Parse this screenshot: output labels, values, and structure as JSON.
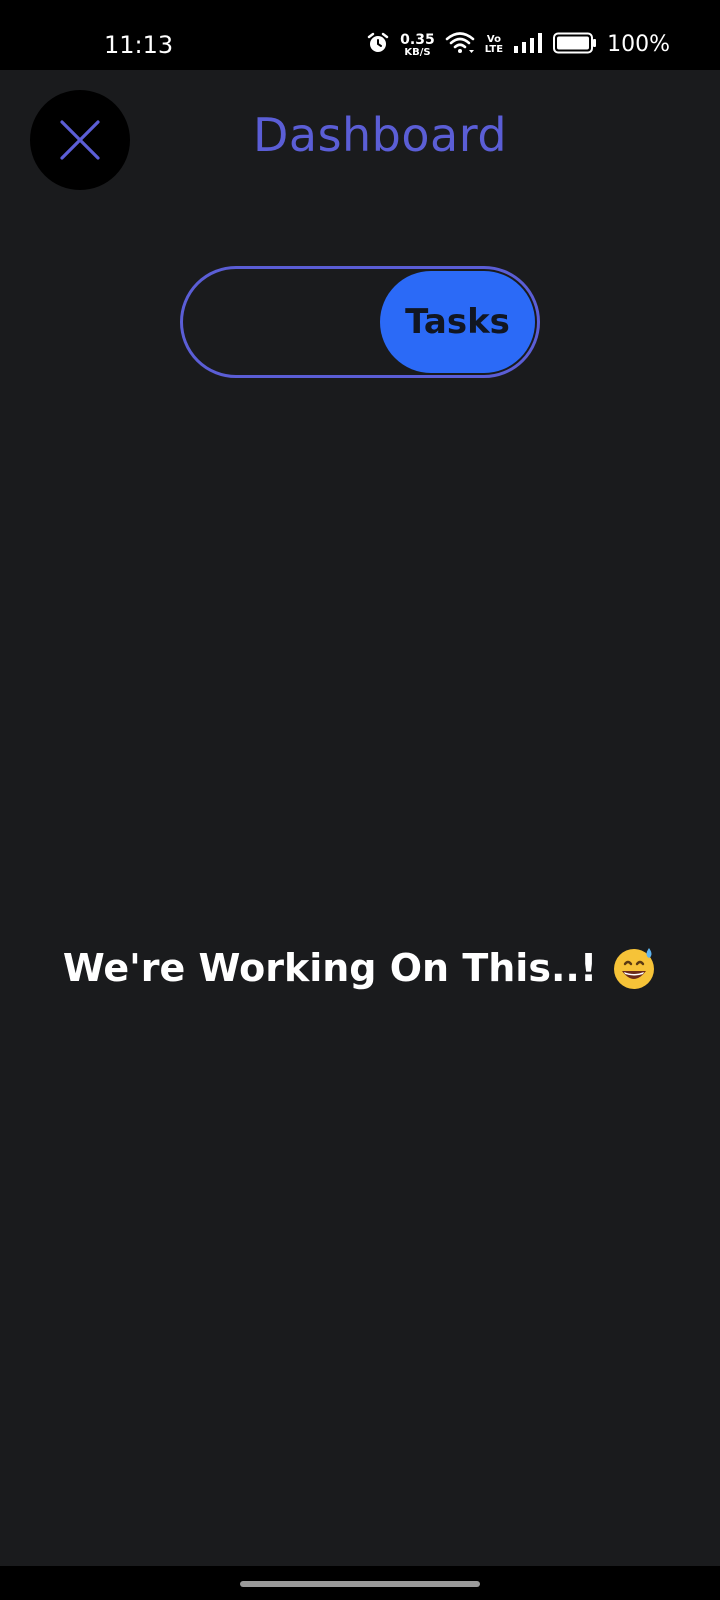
{
  "status_bar": {
    "time": "11:13",
    "net_speed_value": "0.35",
    "net_speed_unit": "KB/S",
    "volte_top": "Vo",
    "volte_bottom": "LTE",
    "battery_percent": "100%",
    "icons": [
      "alarm-icon",
      "wifi-icon",
      "signal-icon",
      "battery-icon"
    ]
  },
  "header": {
    "title": "Dashboard",
    "close_icon": "close-icon"
  },
  "toggle": {
    "selected_label": "Tasks",
    "selected_position": "right"
  },
  "main": {
    "message": "We're Working On This..!",
    "emoji": "grinning-face-with-sweat"
  },
  "colors": {
    "background": "#1a1b1d",
    "accent": "#5b5ed6",
    "toggle_knob": "#2b6af7",
    "text": "#ffffff"
  }
}
